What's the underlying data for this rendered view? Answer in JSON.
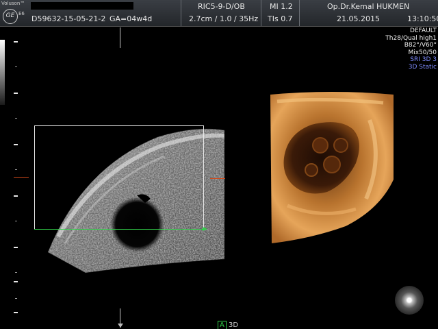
{
  "header": {
    "brand": "Voluson™",
    "model": "E6",
    "logo_text": "GE",
    "patient_name": "",
    "patient_id": "D59632-15-05-21-2",
    "ga": "GA=04w4d",
    "probe": "RIC5-9-D/OB",
    "depth_info": "2.7cm / 1.0 / 35Hz",
    "mi": "MI  1.2",
    "tis": "TIs  0.7",
    "operator": "Op.Dr.Kemal HUKMEN",
    "date": "21.05.2015",
    "time": "13:10:50"
  },
  "params": {
    "preset": "DEFAULT",
    "quality": "Th28/Qual high1",
    "angle": "B82°/V60°",
    "mix": "Mix50/50",
    "sri": "SRI 3D 3",
    "mode": "3D Static"
  },
  "views": {
    "a_label": "A",
    "d3_label": "3D"
  },
  "colors": {
    "roi_green": "#32d24a",
    "marker_red": "#d24a1a",
    "param_blue": "#7f8cff"
  },
  "icons": {
    "logo": "ge-logo-icon",
    "trackball": "trackball-icon"
  }
}
